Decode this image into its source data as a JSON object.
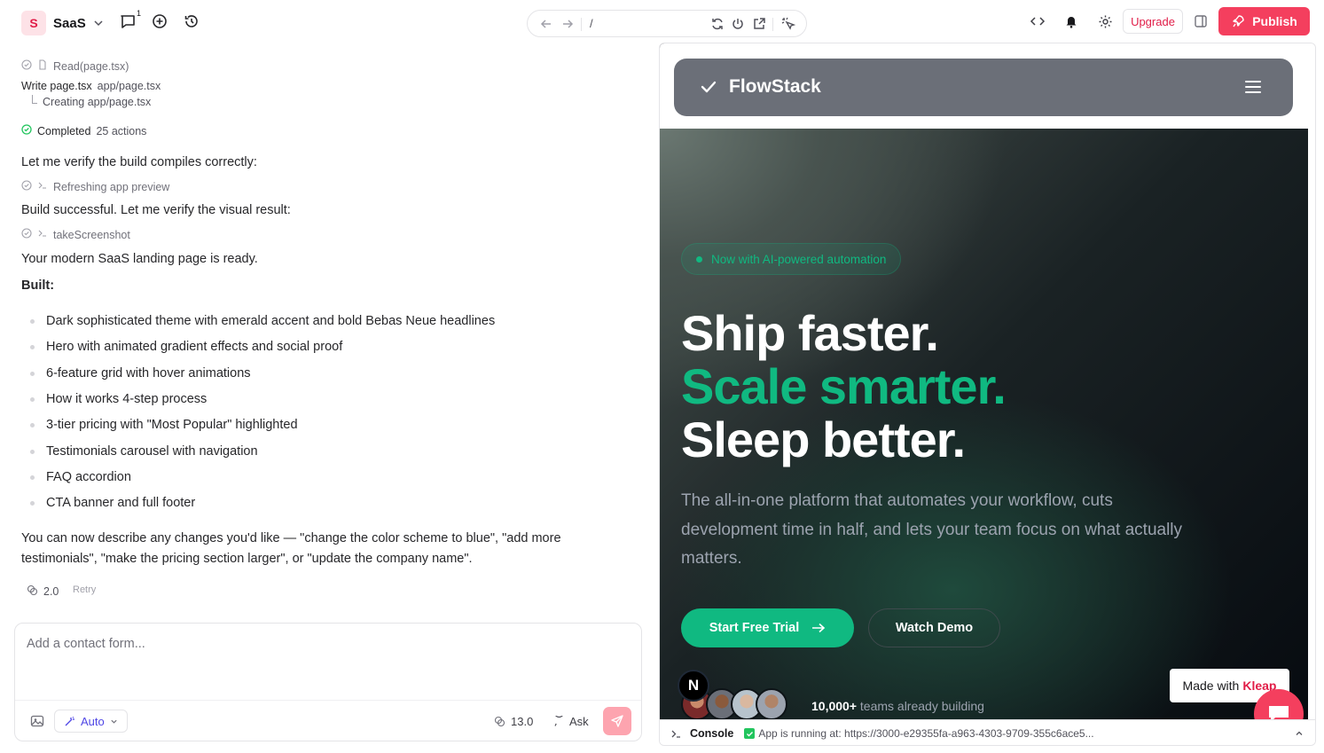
{
  "topbar": {
    "project_initial": "S",
    "project_name": "SaaS",
    "notif_count": "1",
    "url_path": "/",
    "upgrade_label": "Upgrade",
    "publish_label": "Publish"
  },
  "chat": {
    "read_action": "Read(page.tsx)",
    "write_action_bold": "Write page.tsx",
    "write_action_path": "app/page.tsx",
    "creating_text": "Creating app/page.tsx",
    "completed_bold": "Completed",
    "completed_count": "25 actions",
    "verify_text": "Let me verify the build compiles correctly:",
    "refresh_action": "Refreshing app preview",
    "build_success": "Build successful. Let me verify the visual result:",
    "screenshot_action": "takeScreenshot",
    "ready_text": "Your modern SaaS landing page is ready.",
    "built_heading": "Built:",
    "built_items": [
      "Dark sophisticated theme with emerald accent and bold Bebas Neue headlines",
      "Hero with animated gradient effects and social proof",
      "6-feature grid with hover animations",
      "How it works 4-step process",
      "3-tier pricing with \"Most Popular\" highlighted",
      "Testimonials carousel with navigation",
      "FAQ accordion",
      "CTA banner and full footer"
    ],
    "closing_line1": "You can now describe any changes you'd like — \"change the color scheme to blue\", \"add more",
    "closing_line2": "testimonials\", \"make the pricing section larger\", or \"update the company name\".",
    "credits_used": "2.0",
    "retry_label": "Retry"
  },
  "composer": {
    "placeholder": "Add a contact form...",
    "mode_label": "Auto",
    "credits": "13.0",
    "ask_label": "Ask"
  },
  "preview": {
    "brand": "FlowStack",
    "pill_text": "Now with AI-powered automation",
    "headline1": "Ship faster.",
    "headline2": "Scale smarter.",
    "headline3": "Sleep better.",
    "subtitle": "The all-in-one platform that automates your workflow, cuts development time in half, and lets your team focus on what actually matters.",
    "cta_primary": "Start Free Trial",
    "cta_secondary": "Watch Demo",
    "social_bold": "10,000+",
    "social_rest": "teams already building",
    "made_with": "Made with",
    "made_brand": "Kleap",
    "nlogo_letter": "N"
  },
  "console": {
    "label": "Console",
    "status": "App is running at: https://3000-e29355fa-a963-4303-9709-355c6ace5..."
  },
  "colors": {
    "accent": "#f43f5e",
    "emerald": "#10b981"
  }
}
